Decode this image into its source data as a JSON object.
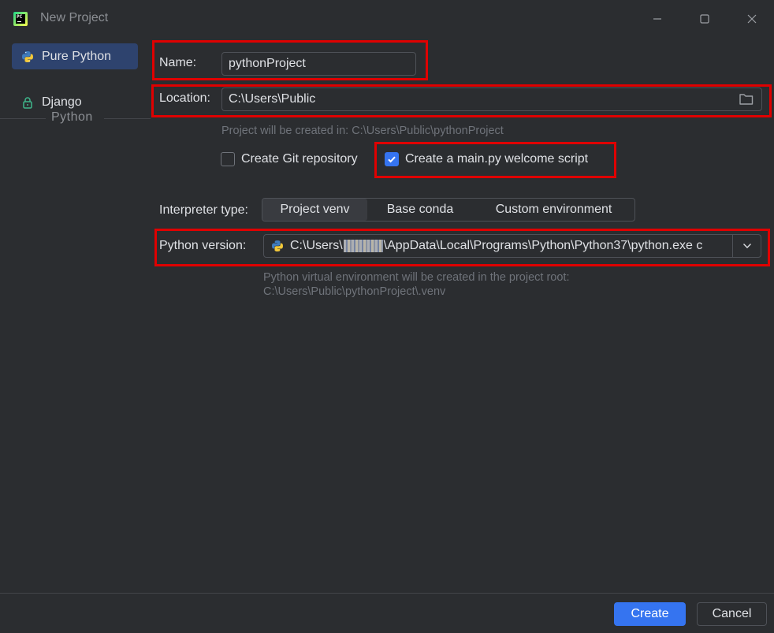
{
  "window": {
    "title": "New Project",
    "colors": {
      "background": "#2b2d30",
      "accent": "#3574f0",
      "selection": "#2e436e",
      "highlight_box": "#e00000"
    }
  },
  "sidebar": {
    "items": [
      {
        "label": "Pure Python",
        "icon": "python-icon",
        "selected": true
      },
      {
        "label": "Django",
        "icon": "lock-icon",
        "selected": false
      }
    ],
    "group_label": "Python"
  },
  "form": {
    "name_label": "Name:",
    "name_value": "pythonProject",
    "location_label": "Location:",
    "location_value": "C:\\Users\\Public",
    "location_hint": "Project will be created in: C:\\Users\\Public\\pythonProject",
    "git_checkbox_label": "Create Git repository",
    "git_checked": false,
    "welcome_checkbox_label": "Create a main.py welcome script",
    "welcome_checked": true,
    "interpreter_label": "Interpreter type:",
    "interpreter_options": [
      "Project venv",
      "Base conda",
      "Custom environment"
    ],
    "interpreter_selected": "Project venv",
    "python_version_label": "Python version:",
    "python_version_prefix": "C:\\Users\\",
    "python_version_suffix": "\\AppData\\Local\\Programs\\Python\\Python37\\python.exe c",
    "venv_hint_line1": "Python virtual environment will be created in the project root:",
    "venv_hint_line2": "C:\\Users\\Public\\pythonProject\\.venv"
  },
  "footer": {
    "create_label": "Create",
    "cancel_label": "Cancel"
  }
}
